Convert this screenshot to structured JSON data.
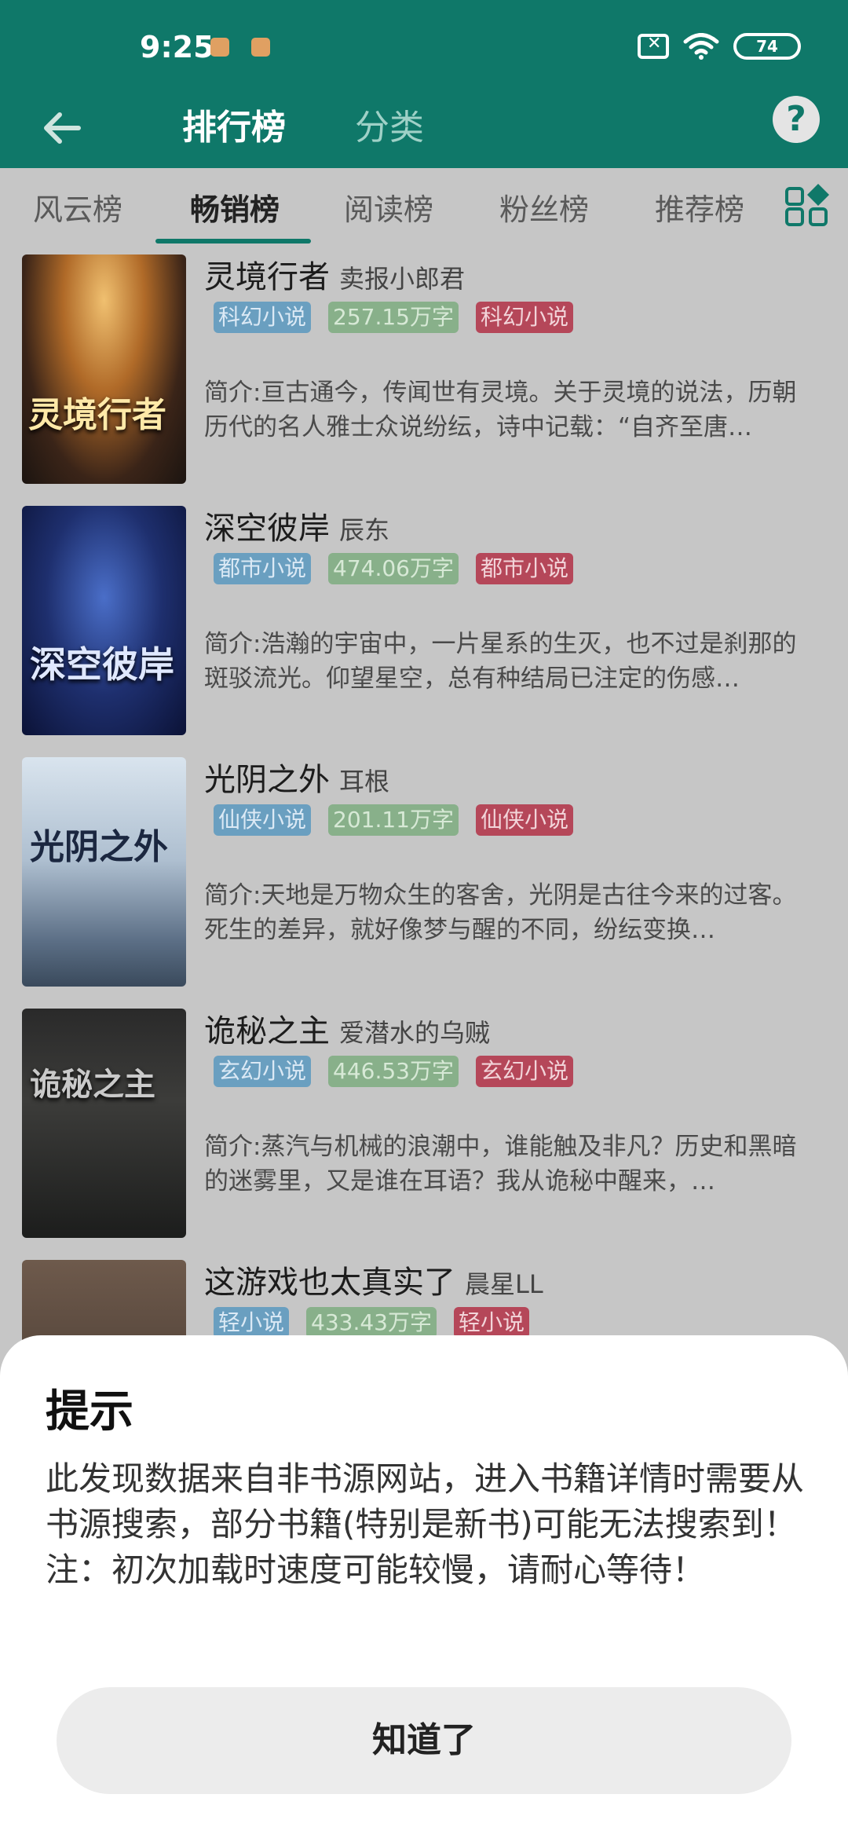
{
  "status_bar": {
    "time": "9:25",
    "battery": "74"
  },
  "nav": {
    "title_active": "排行榜",
    "title_other": "分类"
  },
  "tabs": [
    {
      "label": "风云榜",
      "active": false
    },
    {
      "label": "畅销榜",
      "active": true
    },
    {
      "label": "阅读榜",
      "active": false
    },
    {
      "label": "粉丝榜",
      "active": false
    },
    {
      "label": "推荐榜",
      "active": false
    }
  ],
  "books": [
    {
      "title": "灵境行者",
      "author": "卖报小郎君",
      "tags": [
        "科幻小说",
        "257.15万字",
        "科幻小说"
      ],
      "desc": "简介:亘古通今，传闻世有灵境。关于灵境的说法，历朝历代的名人雅士众说纷纭，诗中记载：“自齐至唐…",
      "cover_text": "灵境行者"
    },
    {
      "title": "深空彼岸",
      "author": "辰东",
      "tags": [
        "都市小说",
        "474.06万字",
        "都市小说"
      ],
      "desc": "简介:浩瀚的宇宙中，一片星系的生灭，也不过是刹那的斑驳流光。仰望星空，总有种结局已注定的伤感…",
      "cover_text": "深空彼岸"
    },
    {
      "title": "光阴之外",
      "author": "耳根",
      "tags": [
        "仙侠小说",
        "201.11万字",
        "仙侠小说"
      ],
      "desc": "简介:天地是万物众生的客舍，光阴是古往今来的过客。死生的差异，就好像梦与醒的不同，纷纭变换…",
      "cover_text": "光阴之外"
    },
    {
      "title": "诡秘之主",
      "author": "爱潜水的乌贼",
      "tags": [
        "玄幻小说",
        "446.53万字",
        "玄幻小说"
      ],
      "desc": "简介:蒸汽与机械的浪潮中，谁能触及非凡？历史和黑暗的迷雾里，又是谁在耳语？我从诡秘中醒来，…",
      "cover_text": "诡秘之主"
    },
    {
      "title": "这游戏也太真实了",
      "author": "晨星LL",
      "tags": [
        "轻小说",
        "433.43万字",
        "轻小说"
      ],
      "desc": "",
      "cover_text": ""
    }
  ],
  "dialog": {
    "title": "提示",
    "body": "此发现数据来自非书源网站，进入书籍详情时需要从书源搜索，部分书籍(特别是新书)可能无法搜索到！\n注：初次加载时速度可能较慢，请耐心等待！",
    "button": "知道了"
  },
  "colors": {
    "header": "#0f7869",
    "tag_blue": "#6a9fc0",
    "tag_green": "#88b08a",
    "tag_red": "#b54759"
  }
}
